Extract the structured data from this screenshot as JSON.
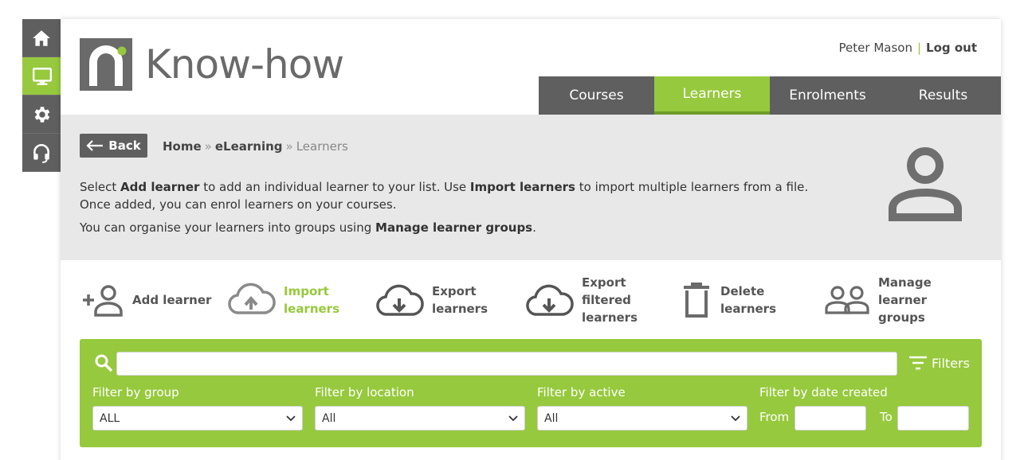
{
  "sidebar": {
    "items": [
      {
        "icon": "home-icon",
        "active": false
      },
      {
        "icon": "monitor-icon",
        "active": true
      },
      {
        "icon": "gear-icon",
        "active": false
      },
      {
        "icon": "headset-icon",
        "active": false
      }
    ]
  },
  "brand": {
    "name": "Know-how",
    "accent": "#96c93d",
    "dark": "#5f5f5f"
  },
  "user": {
    "name": "Peter Mason",
    "separator": "|",
    "logout": "Log out"
  },
  "tabs": [
    {
      "label": "Courses",
      "active": false
    },
    {
      "label": "Learners",
      "active": true
    },
    {
      "label": "Enrolments",
      "active": false
    },
    {
      "label": "Results",
      "active": false
    }
  ],
  "back_label": "Back",
  "breadcrumb": {
    "home": "Home",
    "sep": "»",
    "section": "eLearning",
    "current": "Learners"
  },
  "intro": {
    "l1_a": "Select ",
    "l1_b": "Add learner",
    "l1_c": " to add an individual learner to your list. Use ",
    "l1_d": "Import learners",
    "l1_e": " to import multiple learners from a file.",
    "l2": "Once added, you can enrol learners on your courses.",
    "l3_a": "You can organise your learners into groups using ",
    "l3_b": "Manage learner groups",
    "l3_c": "."
  },
  "actions": [
    {
      "icon": "add-person-icon",
      "line1": "Add learner",
      "line2": "",
      "line3": ""
    },
    {
      "icon": "cloud-upload-icon",
      "line1": "Import",
      "line2": "learners",
      "line3": "",
      "highlight": true
    },
    {
      "icon": "cloud-download-icon",
      "line1": "Export",
      "line2": "learners",
      "line3": ""
    },
    {
      "icon": "cloud-download-icon",
      "line1": "Export",
      "line2": "filtered",
      "line3": "learners"
    },
    {
      "icon": "trash-icon",
      "line1": "Delete",
      "line2": "learners",
      "line3": ""
    },
    {
      "icon": "group-icon",
      "line1": "Manage",
      "line2": "learner",
      "line3": "groups"
    }
  ],
  "search": {
    "value": "",
    "placeholder": "",
    "filters_label": "Filters"
  },
  "filters": {
    "group": {
      "label": "Filter by group",
      "value": "ALL"
    },
    "location": {
      "label": "Filter by location",
      "value": "All"
    },
    "active": {
      "label": "Filter by active",
      "value": "All"
    },
    "date": {
      "label": "Filter by date created",
      "from_label": "From",
      "to_label": "To",
      "from_value": "",
      "to_value": ""
    }
  }
}
